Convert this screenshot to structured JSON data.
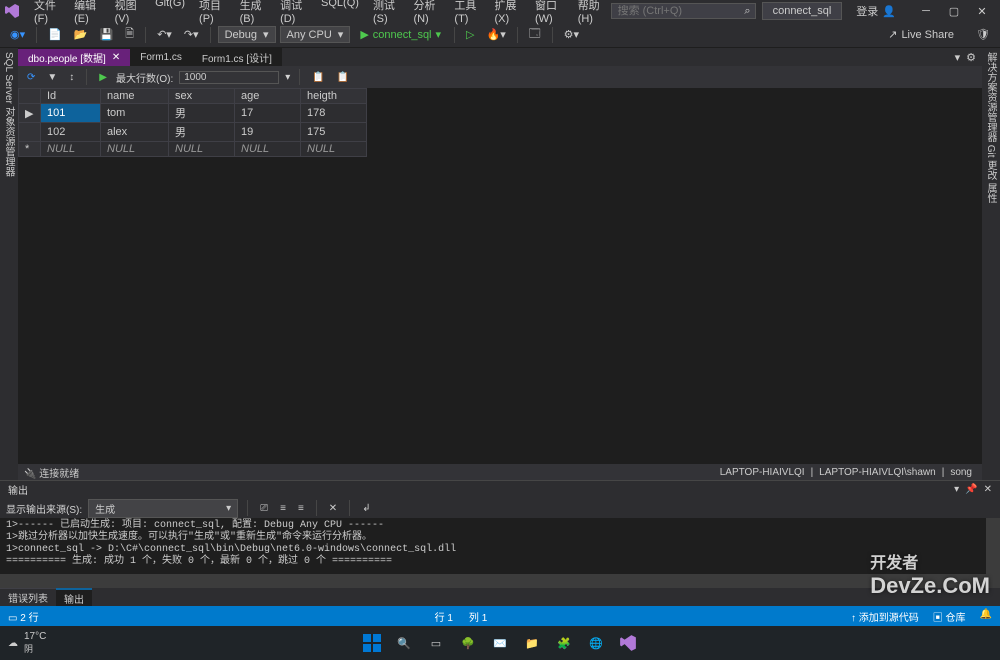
{
  "menu": [
    "文件(F)",
    "编辑(E)",
    "视图(V)",
    "Git(G)",
    "项目(P)",
    "生成(B)",
    "调试(D)",
    "SQL(Q)",
    "测试(S)",
    "分析(N)",
    "工具(T)",
    "扩展(X)",
    "窗口(W)",
    "帮助(H)"
  ],
  "search_placeholder": "搜索 (Ctrl+Q)",
  "project": "connect_sql",
  "login": "登录",
  "toolbar": {
    "config": "Debug",
    "platform": "Any CPU",
    "run_target": "connect_sql",
    "liveshare": "Live Share"
  },
  "side_rail_left": "SQL Server 对象资源管理器",
  "side_rail_right": "解决方案资源管理器   Git 更改   属性",
  "tabs": [
    {
      "label": "dbo.people [数据]",
      "active": true
    },
    {
      "label": "Form1.cs",
      "active": false
    },
    {
      "label": "Form1.cs [设计]",
      "active": false
    }
  ],
  "data_toolbar": {
    "max_rows_label": "最大行数(O):",
    "max_rows_value": "1000"
  },
  "grid": {
    "columns": [
      "Id",
      "name",
      "sex",
      "age",
      "heigth"
    ],
    "rows": [
      {
        "Id": "101",
        "name": "tom",
        "sex": "男",
        "age": "17",
        "heigth": "178",
        "cursor": true,
        "selected": "Id"
      },
      {
        "Id": "102",
        "name": "alex",
        "sex": "男",
        "age": "19",
        "heigth": "175"
      },
      {
        "Id": "NULL",
        "name": "NULL",
        "sex": "NULL",
        "age": "NULL",
        "heigth": "NULL",
        "new": true
      }
    ]
  },
  "conn": {
    "status": "连接就绪",
    "server": "LAPTOP-HIAIVLQI",
    "user": "LAPTOP-HIAIVLQI\\shawn",
    "db": "song"
  },
  "output": {
    "title": "输出",
    "source_label": "显示输出来源(S):",
    "source_value": "生成",
    "lines": [
      "1>------ 已启动生成: 项目: connect_sql, 配置: Debug Any CPU ------",
      "1>跳过分析器以加快生成速度。可以执行\"生成\"或\"重新生成\"命令来运行分析器。",
      "1>connect_sql -> D:\\C#\\connect_sql\\bin\\Debug\\net6.0-windows\\connect_sql.dll",
      "========== 生成: 成功 1 个，失败 0 个，最新 0 个，跳过 0 个 =========="
    ]
  },
  "bottom_tabs": {
    "errors": "错误列表",
    "output": "输出"
  },
  "status": {
    "rows": "2 行",
    "line": "行 1",
    "col": "列 1",
    "add_source": "添加到源代码",
    "push": "↑",
    "repo": "仓库"
  },
  "taskbar": {
    "temp": "17°C",
    "weather": "阴"
  },
  "watermark": "DevZe.CoM",
  "sub_watermark": "开发者"
}
